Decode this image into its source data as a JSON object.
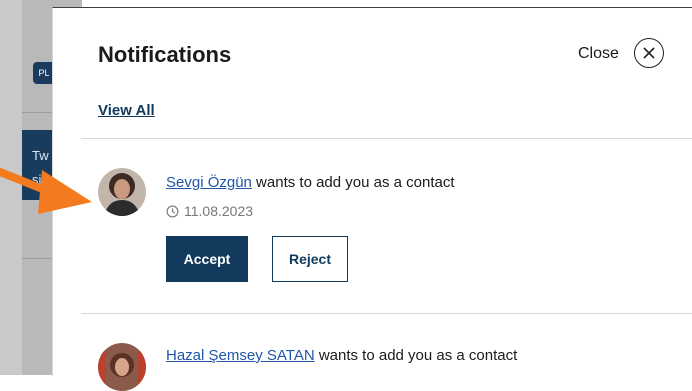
{
  "background": {
    "chip_text": "PL",
    "block_text_line1": "Tw",
    "block_text_line2": "sig"
  },
  "panel": {
    "title": "Notifications",
    "close_label": "Close",
    "view_all_label": "View All"
  },
  "notifications": [
    {
      "name": "Sevgi Özgün",
      "message": " wants to add you as a contact",
      "date": "11.08.2023",
      "accept_label": "Accept",
      "reject_label": "Reject"
    },
    {
      "name": "Hazal Şemsey SATAN",
      "message": " wants to add you as a contact"
    }
  ],
  "colors": {
    "primary": "#123a5c",
    "link": "#1f56a8",
    "arrow": "#f47a20"
  },
  "icons": {
    "close": "close-icon",
    "clock": "clock-icon"
  }
}
